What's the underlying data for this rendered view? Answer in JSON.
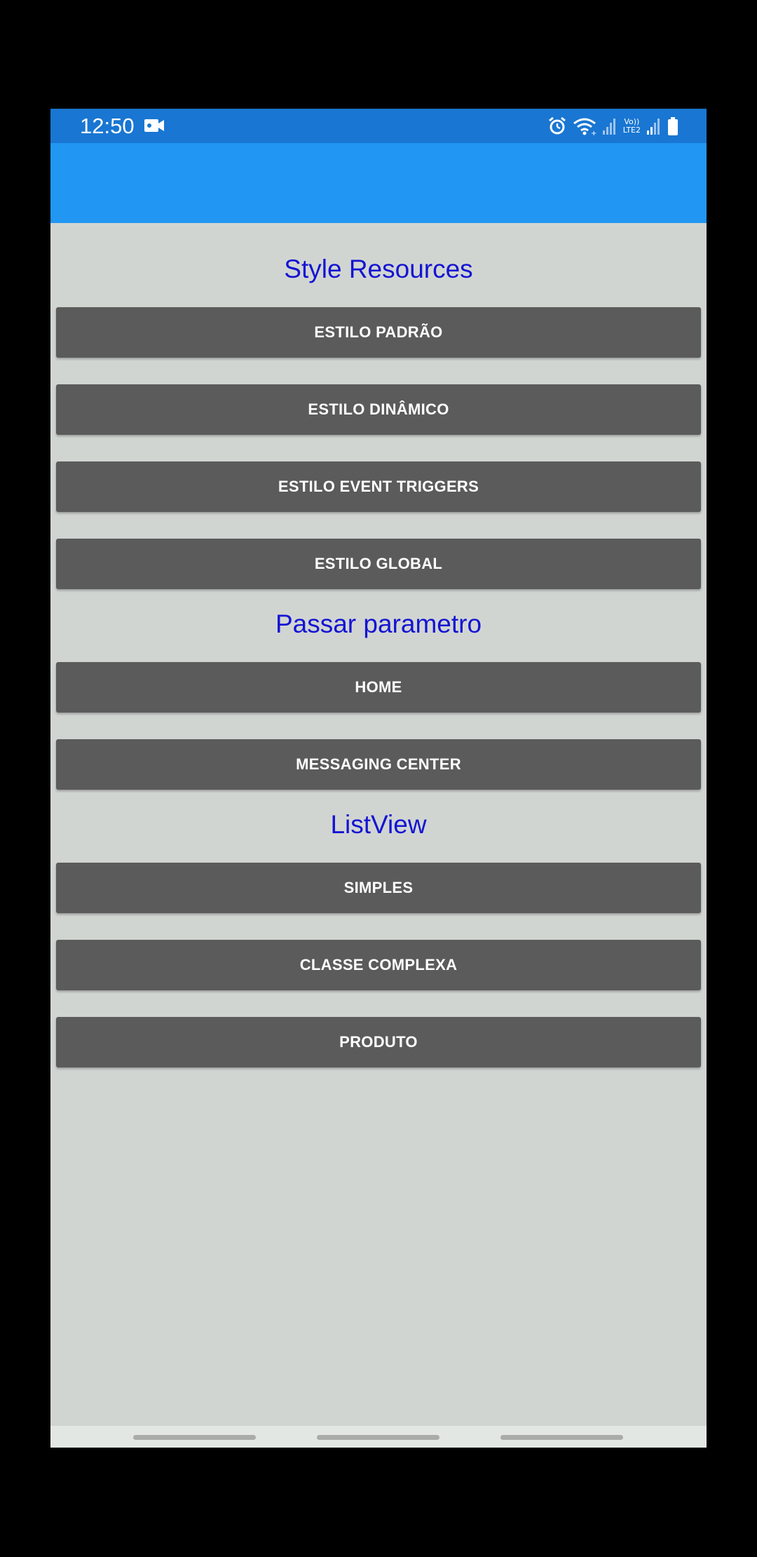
{
  "status_bar": {
    "time": "12:50",
    "left_icons": [
      "video-record-icon"
    ],
    "right_icons": [
      "alarm-icon",
      "wifi-icon",
      "signal-icon",
      "volte-lte2-icon",
      "signal-icon",
      "battery-icon"
    ],
    "lte_label_top": "Vo))",
    "lte_label_bottom": "LTE2"
  },
  "app_bar": {
    "color": "#2196f3"
  },
  "colors": {
    "status_bar": "#1976d2",
    "background": "#d1d5d2",
    "section_title": "#1414d2",
    "button": "#5b5b5b",
    "button_text": "#ffffff"
  },
  "sections": [
    {
      "title": "Style Resources",
      "buttons": [
        "ESTILO PADRÃO",
        "ESTILO DINÂMICO",
        "ESTILO EVENT TRIGGERS",
        "ESTILO GLOBAL"
      ]
    },
    {
      "title": "Passar parametro",
      "buttons": [
        "HOME",
        "MESSAGING CENTER"
      ]
    },
    {
      "title": "ListView",
      "buttons": [
        "SIMPLES",
        "CLASSE COMPLEXA",
        "PRODUTO"
      ]
    }
  ],
  "nav_bar": {
    "items": [
      "recent-apps-gesture",
      "home-gesture",
      "back-gesture"
    ]
  }
}
